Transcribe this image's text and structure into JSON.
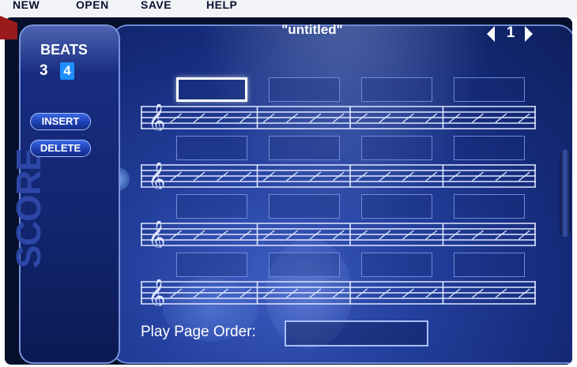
{
  "menu": {
    "items": [
      "NEW",
      "OPEN",
      "SAVE",
      "HELP"
    ]
  },
  "sidebar": {
    "beats_label": "BEATS",
    "beats_options": [
      "3",
      "4"
    ],
    "beats_selected": "4",
    "insert_label": "INSERT",
    "delete_label": "DELETE",
    "panel_title": "SCORE"
  },
  "header": {
    "song_title": "\"untitled\"",
    "page_number": "1"
  },
  "score": {
    "rows": 4,
    "measures_per_row": 4,
    "beats_per_measure": 4,
    "clef": "treble",
    "active_chord_box": {
      "row": 1,
      "measure": 1
    }
  },
  "footer": {
    "play_page_order_label": "Play Page Order:",
    "play_page_order_value": ""
  },
  "colors": {
    "accent": "#1e90ff",
    "panel": "#142a78",
    "frame": "#06102a",
    "line": "#dfe7ff"
  }
}
